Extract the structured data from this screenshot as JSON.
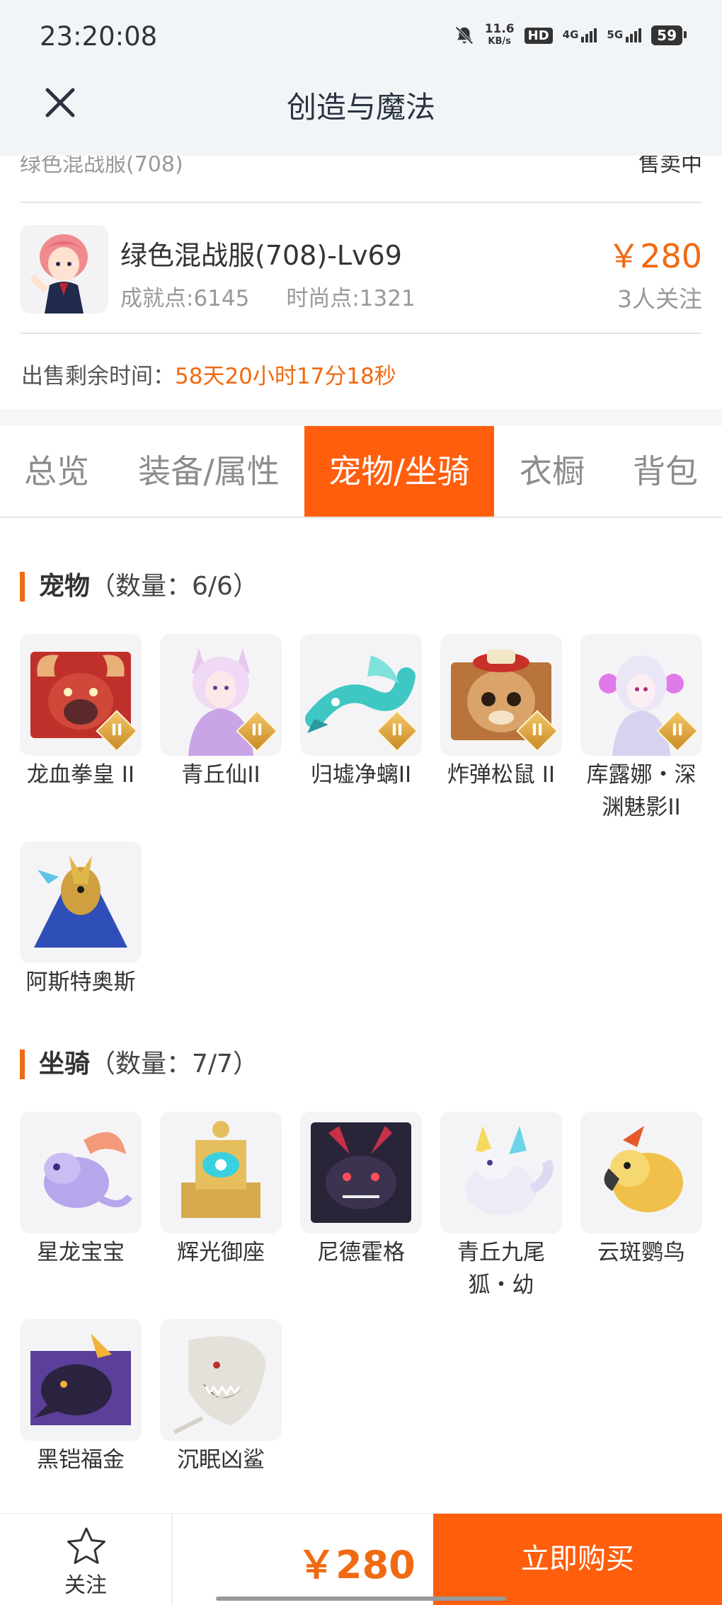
{
  "status_bar": {
    "time": "23:20:08",
    "speed_value": "11.6",
    "speed_unit": "KB/s",
    "hd_label": "HD",
    "net_4g": "4G",
    "net_5g": "5G",
    "battery": "59",
    "icons": [
      "mute-icon",
      "hd-icon",
      "signal-icon",
      "battery-icon"
    ]
  },
  "header": {
    "title": "创造与魔法",
    "close_icon": "close-icon"
  },
  "prev_item": {
    "name": "绿色混战服(708)",
    "status": "售卖中"
  },
  "product": {
    "name": "绿色混战服(708)-Lv69",
    "achievement": "成就点:6145",
    "fashion": "时尚点:1321",
    "price": "￥280",
    "followers": "3人关注"
  },
  "timer": {
    "label": "出售剩余时间：",
    "value": "58天20小时17分18秒"
  },
  "tabs": [
    {
      "label": "总览",
      "active": false
    },
    {
      "label": "装备/属性",
      "active": false
    },
    {
      "label": "宠物/坐骑",
      "active": true
    },
    {
      "label": "衣橱",
      "active": false
    },
    {
      "label": "背包",
      "active": false
    }
  ],
  "pets": {
    "title": "宠物",
    "count": "（数量：6/6）",
    "items": [
      {
        "name": "龙血拳皇 II",
        "badge": "II"
      },
      {
        "name": "青丘仙II",
        "badge": "II"
      },
      {
        "name": "归墟净螭II",
        "badge": "II"
      },
      {
        "name": "炸弹松鼠 II",
        "badge": "II"
      },
      {
        "name": "库露娜・深渊魅影II",
        "badge": "II"
      },
      {
        "name": "阿斯特奥斯"
      }
    ]
  },
  "mounts": {
    "title": "坐骑",
    "count": "（数量：7/7）",
    "items": [
      {
        "name": "星龙宝宝"
      },
      {
        "name": "辉光御座"
      },
      {
        "name": "尼德霍格"
      },
      {
        "name": "青丘九尾狐・幼"
      },
      {
        "name": "云斑鹦鸟"
      },
      {
        "name": "黑铠福金"
      },
      {
        "name": "沉眠凶鲨"
      }
    ]
  },
  "bottom_bar": {
    "follow_label": "关注",
    "price": "￥280",
    "buy_label": "立即购买"
  },
  "colors": {
    "accent": "#ff5e0d",
    "price": "#f06a12",
    "header_bg": "#f2f5f8"
  }
}
